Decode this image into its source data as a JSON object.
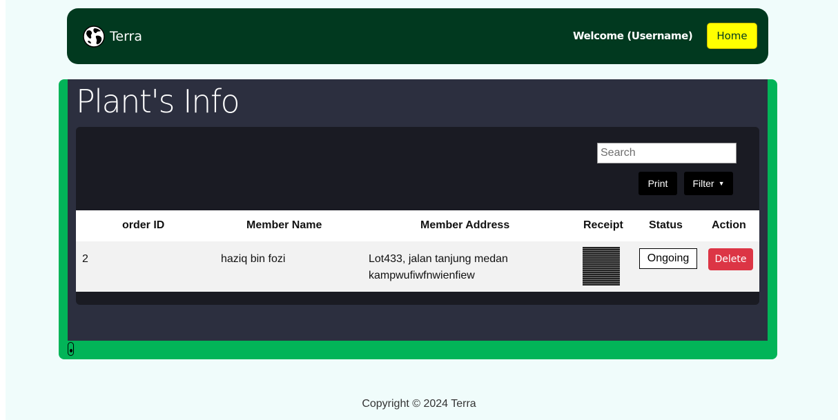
{
  "navbar": {
    "brand": "Terra",
    "brand_icon": "globe-icon",
    "welcome_text": "Welcome (Username)",
    "home_label": "Home"
  },
  "page": {
    "title": "Plant's Info"
  },
  "toolbar": {
    "search_placeholder": "Search",
    "search_value": "",
    "print_label": "Print",
    "filter_label": "Filter"
  },
  "table": {
    "headers": [
      "order ID",
      "Member Name",
      "Member Address",
      "Receipt",
      "Status",
      "Action"
    ],
    "rows": [
      {
        "order_id": "2",
        "member_name": "haziq bin fozi",
        "member_address_line1": "Lot433, jalan tanjung medan",
        "member_address_line2": "kampwufiwfnwienfiew",
        "status": "Ongoing",
        "action_label": "Delete"
      }
    ]
  },
  "footer": {
    "copyright": "Copyright © 2024 Terra"
  },
  "colors": {
    "navbar_bg": "#01391f",
    "accent_green": "#02b458",
    "home_button": "#ffff00",
    "delete_button": "#dc3545",
    "panel_bg": "#2c2f3f"
  }
}
